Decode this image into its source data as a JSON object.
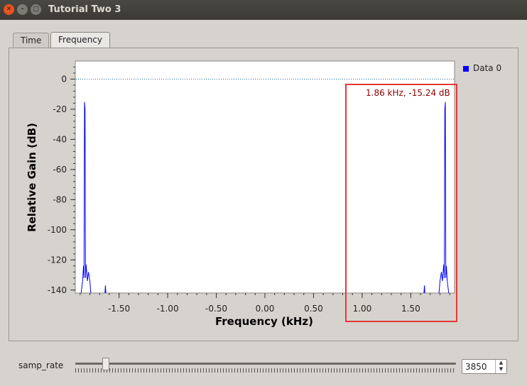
{
  "window": {
    "title": "Tutorial Two 3"
  },
  "tabs": [
    {
      "label": "Time",
      "active": false
    },
    {
      "label": "Frequency",
      "active": true
    }
  ],
  "legend": {
    "label": "Data 0",
    "color": "#0000ff"
  },
  "readout": {
    "text": "1.86 kHz, -15.24 dB",
    "color": "#8b0000"
  },
  "highlight_color": "#e53935",
  "controls": {
    "samp_rate_label": "samp_rate",
    "samp_rate_value": "3850",
    "slider_fraction": 0.08
  },
  "chart_data": {
    "type": "line",
    "xlabel": "Frequency (kHz)",
    "ylabel": "Relative Gain (dB)",
    "xlim": [
      -1.95,
      1.95
    ],
    "ylim": [
      -142,
      12
    ],
    "xticks": [
      "-1.50",
      "-1.00",
      "-0.50",
      "0.00",
      "0.50",
      "1.00",
      "1.50"
    ],
    "xtick_values": [
      -1.5,
      -1.0,
      -0.5,
      0.0,
      0.5,
      1.0,
      1.5
    ],
    "yticks": [
      "0",
      "-20",
      "-40",
      "-60",
      "-80",
      "-100",
      "-120",
      "-140"
    ],
    "ytick_values": [
      0,
      -20,
      -40,
      -60,
      -80,
      -100,
      -120,
      -140
    ],
    "reference_line": {
      "y": 0,
      "style": "dotted"
    },
    "series": [
      {
        "name": "Data 0",
        "color": "#0000ff",
        "x": [
          -1.89,
          -1.875,
          -1.865,
          -1.86,
          -1.855,
          -1.85,
          -1.845,
          -1.84,
          -1.835,
          -1.825,
          -1.815,
          -1.8,
          -1.79
        ],
        "y": [
          -142,
          -134,
          -124,
          -132,
          -15.24,
          -20,
          -132,
          -123,
          -126,
          -134,
          -128,
          -134,
          -142
        ]
      },
      {
        "name": "Data 0",
        "color": "#0000ff",
        "x": [
          -1.645,
          -1.64,
          -1.635
        ],
        "y": [
          -142,
          -137,
          -142
        ]
      },
      {
        "name": "Data 0",
        "color": "#0000ff",
        "x": [
          1.635,
          1.64,
          1.645
        ],
        "y": [
          -142,
          -137,
          -142
        ]
      },
      {
        "name": "Data 0",
        "color": "#0000ff",
        "x": [
          1.79,
          1.8,
          1.815,
          1.825,
          1.835,
          1.84,
          1.845,
          1.85,
          1.855,
          1.86,
          1.865,
          1.875,
          1.89
        ],
        "y": [
          -142,
          -134,
          -128,
          -134,
          -126,
          -123,
          -132,
          -20,
          -15.24,
          -132,
          -124,
          -134,
          -142
        ]
      }
    ]
  }
}
